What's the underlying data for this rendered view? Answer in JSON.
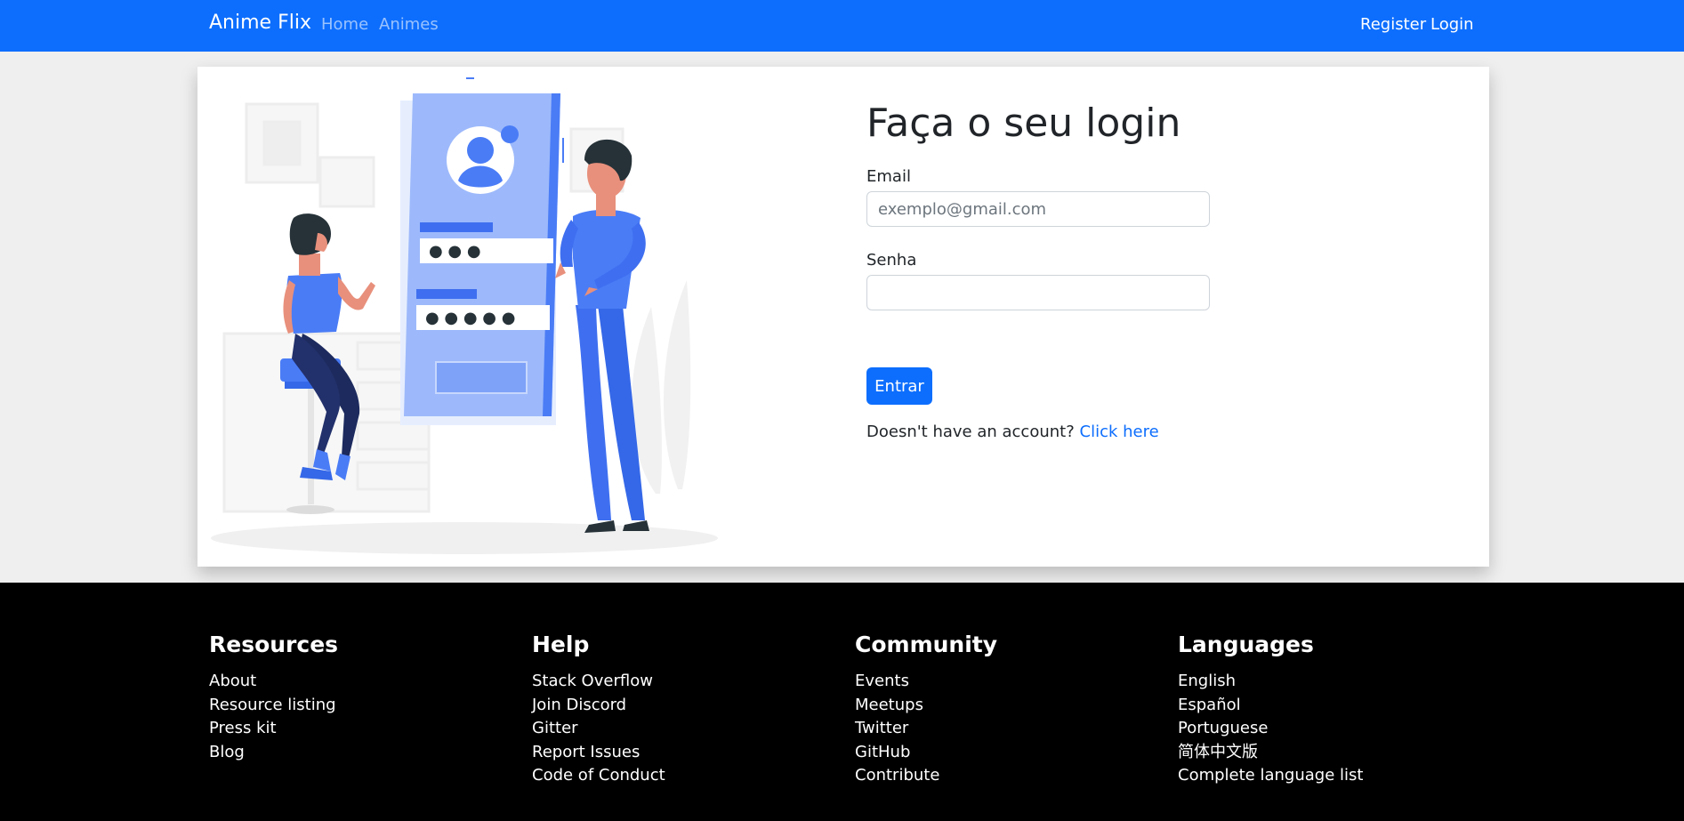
{
  "navbar": {
    "brand": "Anime Flix",
    "left_links": [
      "Home",
      "Animes"
    ],
    "right_links": [
      "Register",
      "Login"
    ],
    "color": "#0d6efd"
  },
  "login": {
    "title": "Faça o seu login",
    "email_label": "Email",
    "email_placeholder": "exemplo@gmail.com",
    "email_value": "",
    "password_label": "Senha",
    "password_value": "",
    "submit_label": "Entrar",
    "account_prompt": "Doesn't have an account?",
    "account_link": "Click here"
  },
  "illustration": {
    "description_icon": "login-illustration",
    "password_field_1_mask": "● ● ●",
    "password_field_2_mask": "● ● ● ● ●"
  },
  "footer": {
    "columns": [
      {
        "title": "Resources",
        "items": [
          "About",
          "Resource listing",
          "Press kit",
          "Blog"
        ]
      },
      {
        "title": "Help",
        "items": [
          "Stack Overflow",
          "Join Discord",
          "Gitter",
          "Report Issues",
          "Code of Conduct"
        ]
      },
      {
        "title": "Community",
        "items": [
          "Events",
          "Meetups",
          "Twitter",
          "GitHub",
          "Contribute"
        ]
      },
      {
        "title": "Languages",
        "items": [
          "English",
          "Español",
          "Portuguese",
          "简体中文版",
          "Complete language list"
        ]
      }
    ]
  },
  "colors": {
    "primary": "#0d6efd",
    "page_background": "#efefef",
    "footer_background": "#000000"
  }
}
